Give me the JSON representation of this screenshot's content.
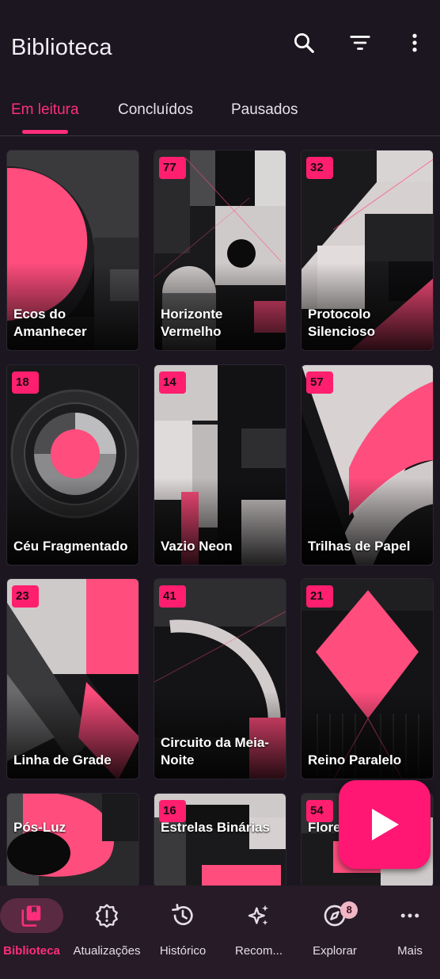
{
  "header": {
    "title": "Biblioteca",
    "icons": [
      "search-icon",
      "filter-icon",
      "more-vert-icon"
    ]
  },
  "tabs": [
    {
      "label": "Em leitura",
      "active": true
    },
    {
      "label": "Concluídos",
      "active": false
    },
    {
      "label": "Pausados",
      "active": false
    }
  ],
  "library": {
    "items": [
      {
        "title": "Ecos do Amanhecer",
        "badge": ""
      },
      {
        "title": "Horizonte Vermelho",
        "badge": "77"
      },
      {
        "title": "Protocolo Silencioso",
        "badge": "32"
      },
      {
        "title": "Céu Fragmentado",
        "badge": "18"
      },
      {
        "title": "Vazio Neon",
        "badge": "14"
      },
      {
        "title": "Trilhas de Papel",
        "badge": "57"
      },
      {
        "title": "Linha de Grade",
        "badge": "23"
      },
      {
        "title": "Circuito da Meia-Noite",
        "badge": "41"
      },
      {
        "title": "Reino Paralelo",
        "badge": "21"
      },
      {
        "title": "Pós-Luz",
        "badge": ""
      },
      {
        "title": "Estrelas Binárias",
        "badge": "16"
      },
      {
        "title": "Flore",
        "badge": "54"
      }
    ]
  },
  "fab": {
    "icon": "play-icon"
  },
  "bottom_nav": [
    {
      "label": "Biblioteca",
      "icon": "library-icon",
      "active": true
    },
    {
      "label": "Atualizações",
      "icon": "alert-badge-icon",
      "active": false
    },
    {
      "label": "Histórico",
      "icon": "history-icon",
      "active": false
    },
    {
      "label": "Recom...",
      "icon": "sparkle-icon",
      "active": false
    },
    {
      "label": "Explorar",
      "icon": "explore-icon",
      "active": false,
      "badge": "8"
    },
    {
      "label": "Mais",
      "icon": "more-horiz-icon",
      "active": false
    }
  ],
  "colors": {
    "accent": "#ff2e7a",
    "background": "#1b161f",
    "nav_background": "#261b27"
  }
}
